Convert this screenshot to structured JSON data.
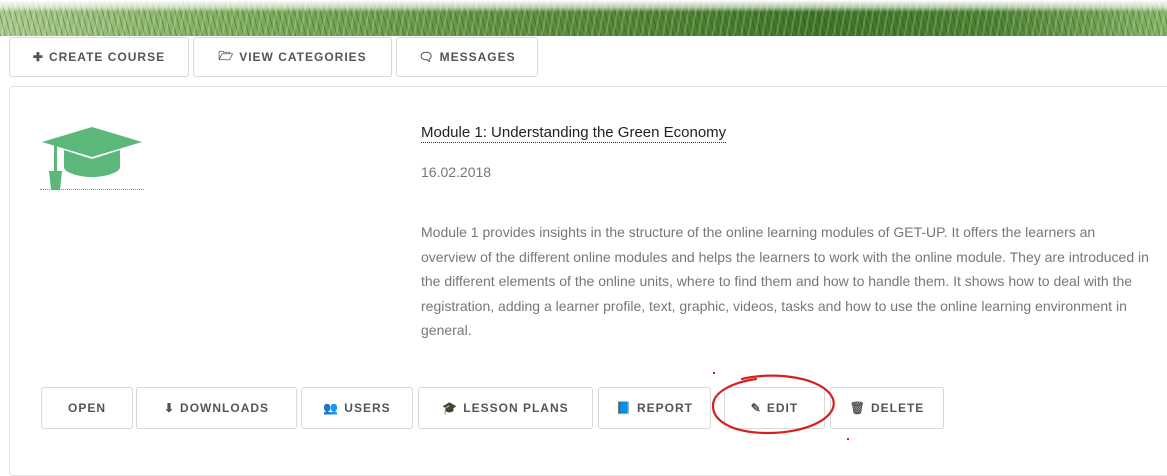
{
  "top_tabs": [
    {
      "label": "CREATE COURSE",
      "icon": "plus-icon",
      "glyph": "✚"
    },
    {
      "label": "VIEW CATEGORIES",
      "icon": "folder-open-icon",
      "glyph": "🗁"
    },
    {
      "label": "MESSAGES",
      "icon": "chat-bubbles-icon",
      "glyph": "🗨"
    }
  ],
  "course": {
    "icon": "graduation-cap-icon",
    "icon_color": "#5cb87a",
    "title": "Module 1: Understanding the Green Economy",
    "date": "16.02.2018",
    "description": "Module 1 provides insights in the structure of the online learning modules of GET-UP. It offers the learners an overview of the different online modules and helps the learners to work with the online module. They are introduced in the different elements of the online units, where to find them and how to handle them. It shows how to deal with the registration, adding a learner profile, text, graphic, videos, tasks and how to use the online learning environment in general."
  },
  "actions": [
    {
      "label": "OPEN",
      "icon": "",
      "glyph": ""
    },
    {
      "label": "DOWNLOADS",
      "icon": "download-icon",
      "glyph": "⬇"
    },
    {
      "label": "USERS",
      "icon": "users-icon",
      "glyph": "👥"
    },
    {
      "label": "LESSON PLANS",
      "icon": "graduation-cap-icon",
      "glyph": "🎓"
    },
    {
      "label": "REPORT",
      "icon": "book-icon",
      "glyph": "📘"
    },
    {
      "label": "EDIT",
      "icon": "pencil-icon",
      "glyph": "✎"
    },
    {
      "label": "DELETE",
      "icon": "trash-icon",
      "glyph": "🗑"
    }
  ],
  "annotation_color": "#d62020"
}
